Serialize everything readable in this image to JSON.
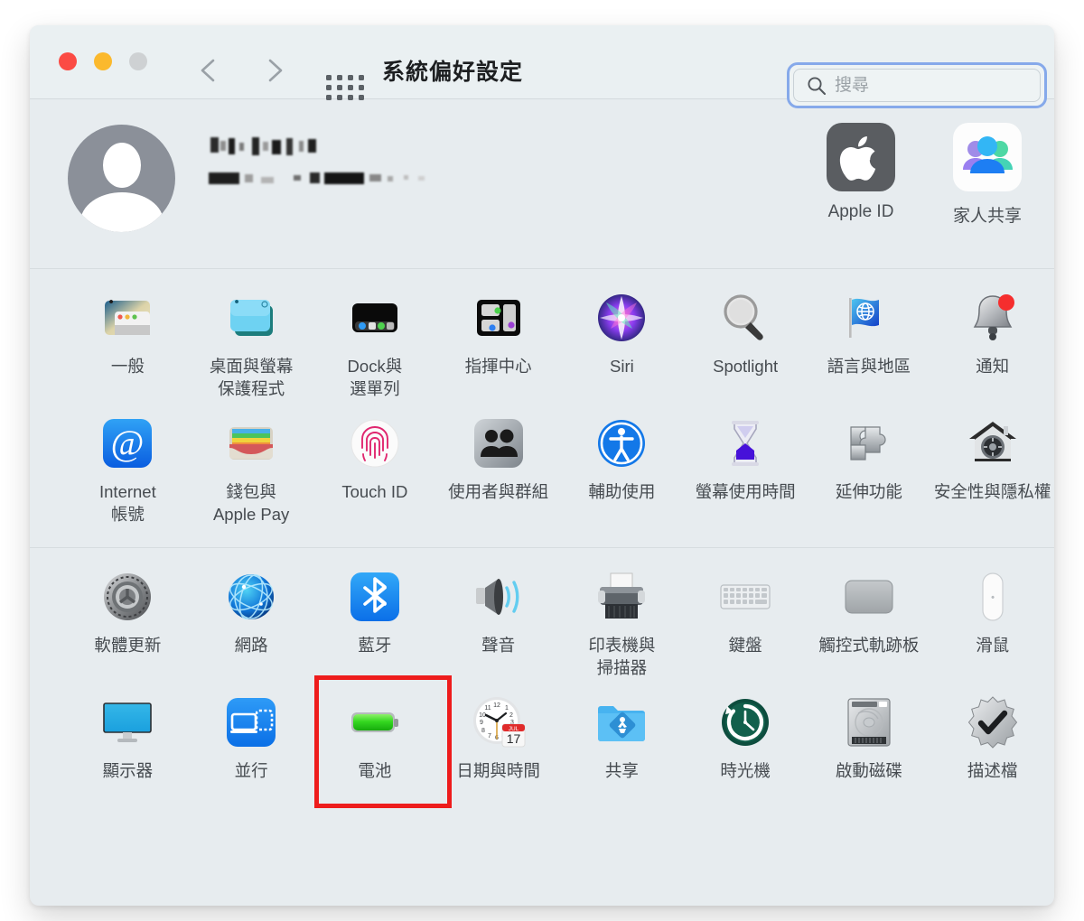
{
  "window": {
    "title": "系統偏好設定",
    "traffic_lights": [
      {
        "name": "close",
        "color": "#fb4b44"
      },
      {
        "name": "minimize",
        "color": "#fbb92d"
      },
      {
        "name": "zoom",
        "color": "#ced1d3"
      }
    ],
    "nav": {
      "back_icon": "chevron-left-icon",
      "forward_icon": "chevron-right-icon"
    },
    "grid_icon": "show-all-grid-icon"
  },
  "search": {
    "placeholder": "搜尋",
    "value": "",
    "icon": "search-icon",
    "focus_ring_color": "#86a9ea"
  },
  "account": {
    "avatar_icon": "default-user-avatar-icon",
    "name_redacted": true,
    "email_redacted": true,
    "shortcuts": [
      {
        "label": "Apple ID",
        "icon": "apple-logo-icon"
      },
      {
        "label": "家人共享",
        "icon": "family-sharing-icon"
      }
    ]
  },
  "sections": [
    {
      "id": "personal",
      "rows": [
        [
          {
            "label": "一般",
            "icon": "general-window-icon"
          },
          {
            "label": "桌面與螢幕\n保護程式",
            "icon": "desktop-screensaver-icon"
          },
          {
            "label": "Dock與\n選單列",
            "icon": "dock-menubar-icon"
          },
          {
            "label": "指揮中心",
            "icon": "mission-control-icon"
          },
          {
            "label": "Siri",
            "icon": "siri-icon"
          },
          {
            "label": "Spotlight",
            "icon": "spotlight-magnifier-icon"
          },
          {
            "label": "語言與地區",
            "icon": "language-region-flag-icon"
          },
          {
            "label": "通知",
            "icon": "notifications-bell-icon"
          }
        ],
        [
          {
            "label": "Internet\n帳號",
            "icon": "internet-accounts-at-icon"
          },
          {
            "label": "錢包與\nApple Pay",
            "icon": "wallet-apple-pay-icon"
          },
          {
            "label": "Touch ID",
            "icon": "touch-id-fingerprint-icon"
          },
          {
            "label": "使用者與群組",
            "icon": "users-groups-icon"
          },
          {
            "label": "輔助使用",
            "icon": "accessibility-icon"
          },
          {
            "label": "螢幕使用時間",
            "icon": "screen-time-hourglass-icon"
          },
          {
            "label": "延伸功能",
            "icon": "extensions-puzzle-icon"
          },
          {
            "label": "安全性與隱私權",
            "icon": "security-privacy-house-icon"
          }
        ]
      ]
    },
    {
      "id": "hardware",
      "rows": [
        [
          {
            "label": "軟體更新",
            "icon": "software-update-gear-icon"
          },
          {
            "label": "網路",
            "icon": "network-globe-icon"
          },
          {
            "label": "藍牙",
            "icon": "bluetooth-icon"
          },
          {
            "label": "聲音",
            "icon": "sound-speaker-icon"
          },
          {
            "label": "印表機與\n掃描器",
            "icon": "printers-scanners-icon"
          },
          {
            "label": "鍵盤",
            "icon": "keyboard-icon"
          },
          {
            "label": "觸控式軌跡板",
            "icon": "trackpad-icon"
          },
          {
            "label": "滑鼠",
            "icon": "mouse-icon"
          }
        ],
        [
          {
            "label": "顯示器",
            "icon": "displays-monitor-icon"
          },
          {
            "label": "並行",
            "icon": "sidecar-icon"
          },
          {
            "label": "電池",
            "icon": "battery-icon",
            "highlighted": true
          },
          {
            "label": "日期與時間",
            "icon": "date-time-clock-icon",
            "badge_month": "JUL",
            "badge_day": "17"
          },
          {
            "label": "共享",
            "icon": "sharing-folder-icon"
          },
          {
            "label": "時光機",
            "icon": "time-machine-icon"
          },
          {
            "label": "啟動磁碟",
            "icon": "startup-disk-icon"
          },
          {
            "label": "描述檔",
            "icon": "profiles-badge-icon"
          }
        ]
      ]
    }
  ],
  "highlight": {
    "color": "#ee1c1c",
    "target": "電池"
  }
}
